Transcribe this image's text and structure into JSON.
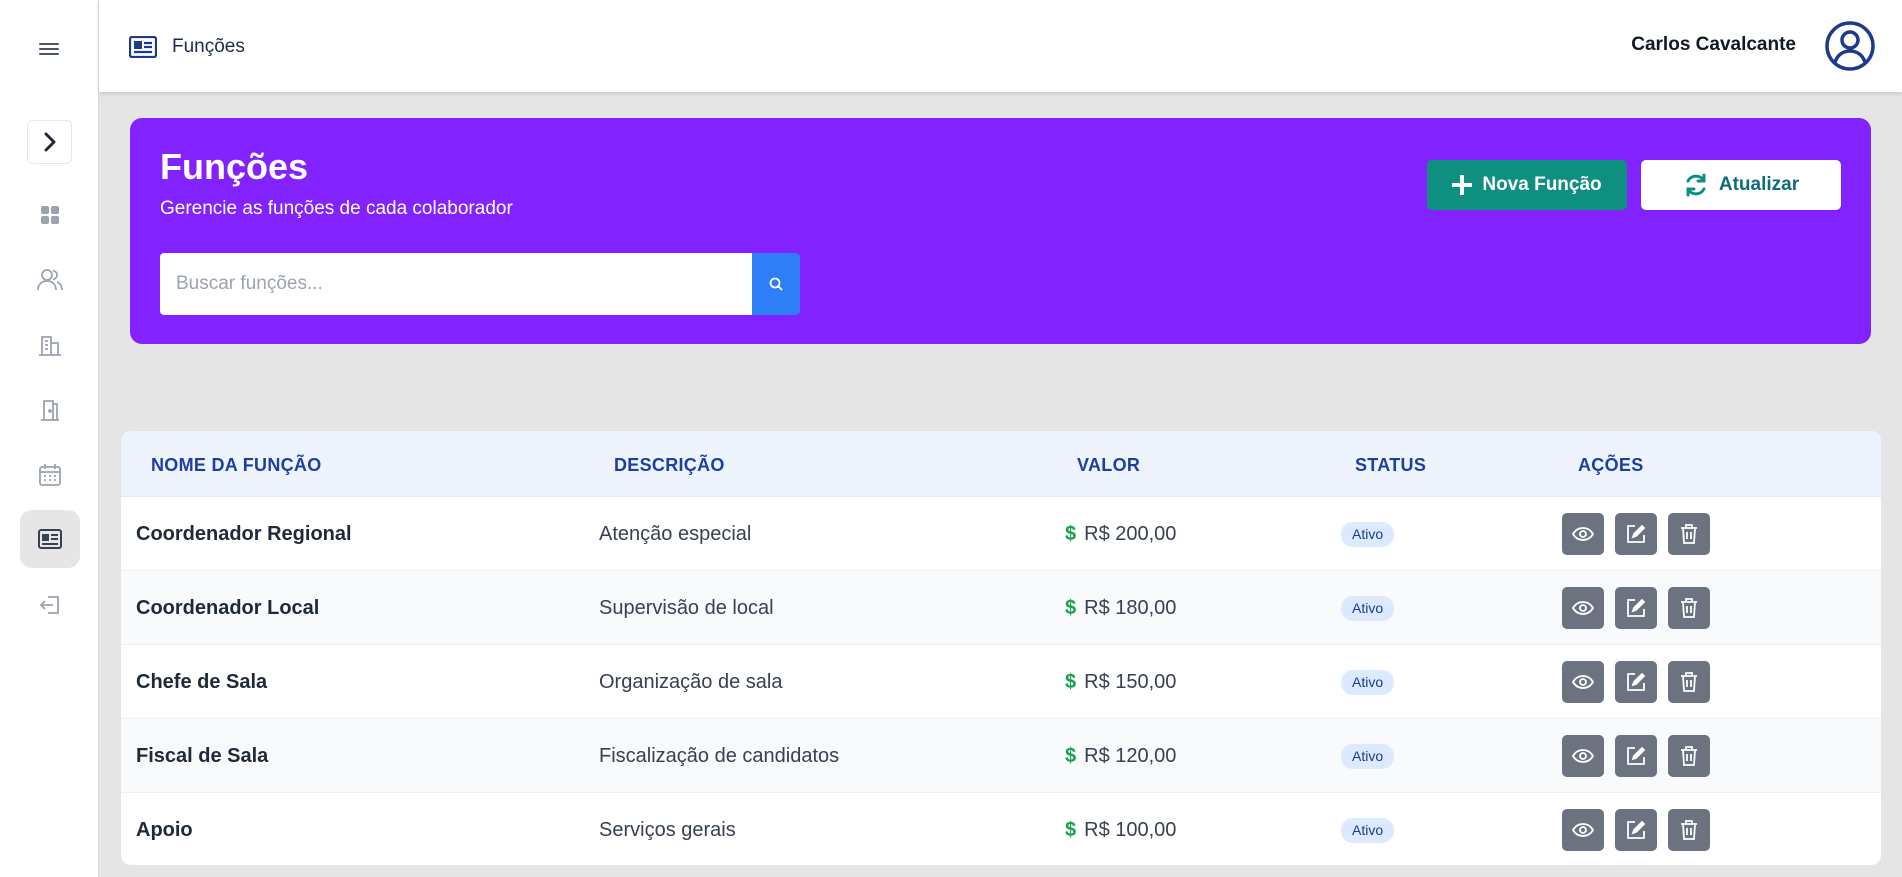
{
  "header": {
    "title": "Funções",
    "user_name": "Carlos Cavalcante"
  },
  "sidebar": {
    "items": [
      {
        "name": "dashboard",
        "icon": "grid-icon"
      },
      {
        "name": "users",
        "icon": "users-icon"
      },
      {
        "name": "buildings",
        "icon": "building-icon"
      },
      {
        "name": "rooms",
        "icon": "door-icon"
      },
      {
        "name": "calendar",
        "icon": "calendar-icon"
      },
      {
        "name": "functions",
        "icon": "id-card-icon",
        "active": true
      },
      {
        "name": "logout",
        "icon": "logout-icon"
      }
    ]
  },
  "hero": {
    "title": "Funções",
    "subtitle": "Gerencie as funções de cada colaborador",
    "search_placeholder": "Buscar funções...",
    "new_button": "Nova Função",
    "refresh_button": "Atualizar"
  },
  "table": {
    "columns": [
      "NOME DA FUNÇÃO",
      "DESCRIÇÃO",
      "VALOR",
      "STATUS",
      "AÇÕES"
    ],
    "rows": [
      {
        "name": "Coordenador Regional",
        "description": "Atenção especial",
        "value": "R$ 200,00",
        "status": "Ativo"
      },
      {
        "name": "Coordenador Local",
        "description": "Supervisão de local",
        "value": "R$ 180,00",
        "status": "Ativo"
      },
      {
        "name": "Chefe de Sala",
        "description": "Organização de sala",
        "value": "R$ 150,00",
        "status": "Ativo"
      },
      {
        "name": "Fiscal de Sala",
        "description": "Fiscalização de candidatos",
        "value": "R$ 120,00",
        "status": "Ativo"
      },
      {
        "name": "Apoio",
        "description": "Serviços gerais",
        "value": "R$ 100,00",
        "status": "Ativo"
      }
    ]
  },
  "colors": {
    "hero_bg": "#8122ff",
    "primary_button": "#0f8f7f",
    "search_button": "#2e7ff5",
    "header_text": "#1e3fa0",
    "money_icon": "#16a34a",
    "action_button": "#6b7280"
  }
}
